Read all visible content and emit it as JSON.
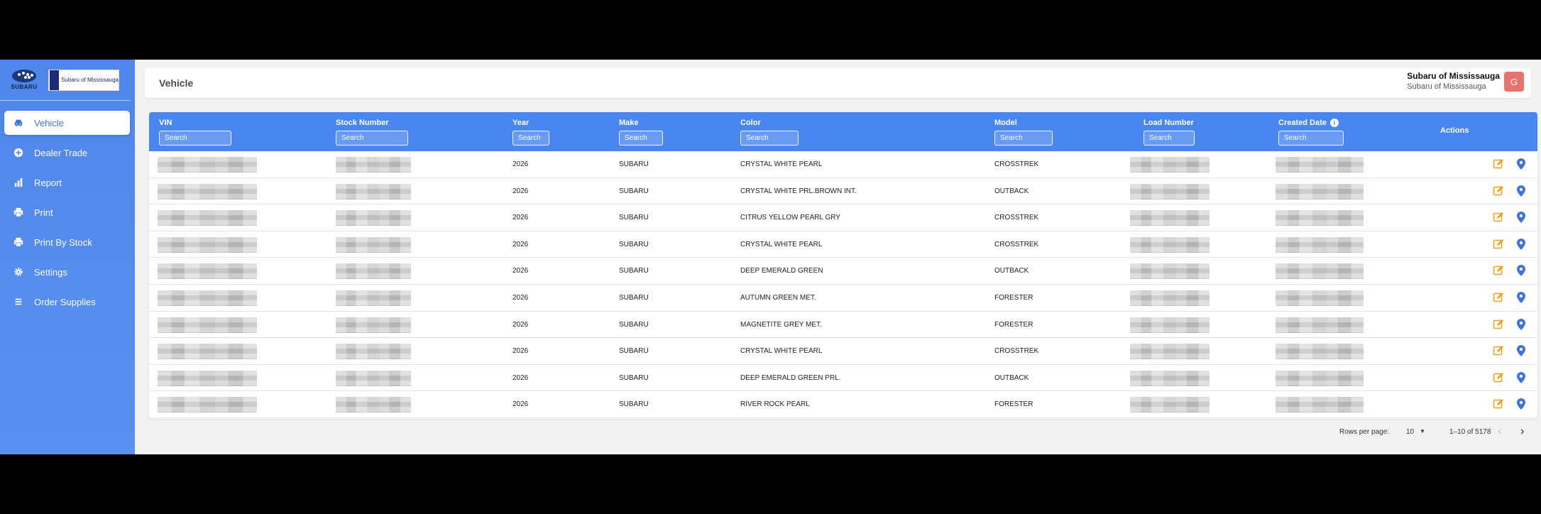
{
  "brand": {
    "oem": "SUBARU",
    "dealer": "Subaru of Mississauga"
  },
  "sidebar": {
    "items": [
      {
        "label": "Vehicle",
        "icon": "car-icon",
        "active": true
      },
      {
        "label": "Dealer Trade",
        "icon": "plus-circle-icon"
      },
      {
        "label": "Report",
        "icon": "bar-chart-icon"
      },
      {
        "label": "Print",
        "icon": "printer-icon"
      },
      {
        "label": "Print By Stock",
        "icon": "printer-icon"
      },
      {
        "label": "Settings",
        "icon": "gear-icon"
      },
      {
        "label": "Order Supplies",
        "icon": "list-icon"
      }
    ]
  },
  "header": {
    "title": "Vehicle",
    "user_name": "Subaru of Mississauga",
    "user_sub": "Subaru of Mississauga",
    "avatar": "G"
  },
  "table": {
    "columns": {
      "vin": "VIN",
      "stock": "Stock Number",
      "year": "Year",
      "make": "Make",
      "color": "Color",
      "model": "Model",
      "load": "Load Number",
      "created": "Created Date",
      "actions": "Actions"
    },
    "search_placeholder": "Search",
    "rows": [
      {
        "year": "2026",
        "make": "SUBARU",
        "color": "CRYSTAL WHITE PEARL",
        "model": "CROSSTREK"
      },
      {
        "year": "2026",
        "make": "SUBARU",
        "color": "CRYSTAL WHITE PRL.BROWN INT.",
        "model": "OUTBACK"
      },
      {
        "year": "2026",
        "make": "SUBARU",
        "color": "CITRUS YELLOW PEARL GRY",
        "model": "CROSSTREK"
      },
      {
        "year": "2026",
        "make": "SUBARU",
        "color": "CRYSTAL WHITE PEARL",
        "model": "CROSSTREK"
      },
      {
        "year": "2026",
        "make": "SUBARU",
        "color": "DEEP EMERALD GREEN",
        "model": "OUTBACK"
      },
      {
        "year": "2026",
        "make": "SUBARU",
        "color": "AUTUMN GREEN MET.",
        "model": "FORESTER"
      },
      {
        "year": "2026",
        "make": "SUBARU",
        "color": "MAGNETITE GREY MET.",
        "model": "FORESTER"
      },
      {
        "year": "2026",
        "make": "SUBARU",
        "color": "CRYSTAL WHITE PEARL",
        "model": "CROSSTREK"
      },
      {
        "year": "2026",
        "make": "SUBARU",
        "color": "DEEP EMERALD GREEN PRL.",
        "model": "OUTBACK"
      },
      {
        "year": "2026",
        "make": "SUBARU",
        "color": "RIVER ROCK PEARL",
        "model": "FORESTER"
      }
    ]
  },
  "pagination": {
    "rows_per_page_label": "Rows per page:",
    "rows_per_page": "10",
    "range": "1–10 of 5178"
  },
  "colors": {
    "accent": "#4a86f0",
    "edit": "#f0a020",
    "pin": "#3b74e0",
    "avatar": "#e8736c"
  }
}
